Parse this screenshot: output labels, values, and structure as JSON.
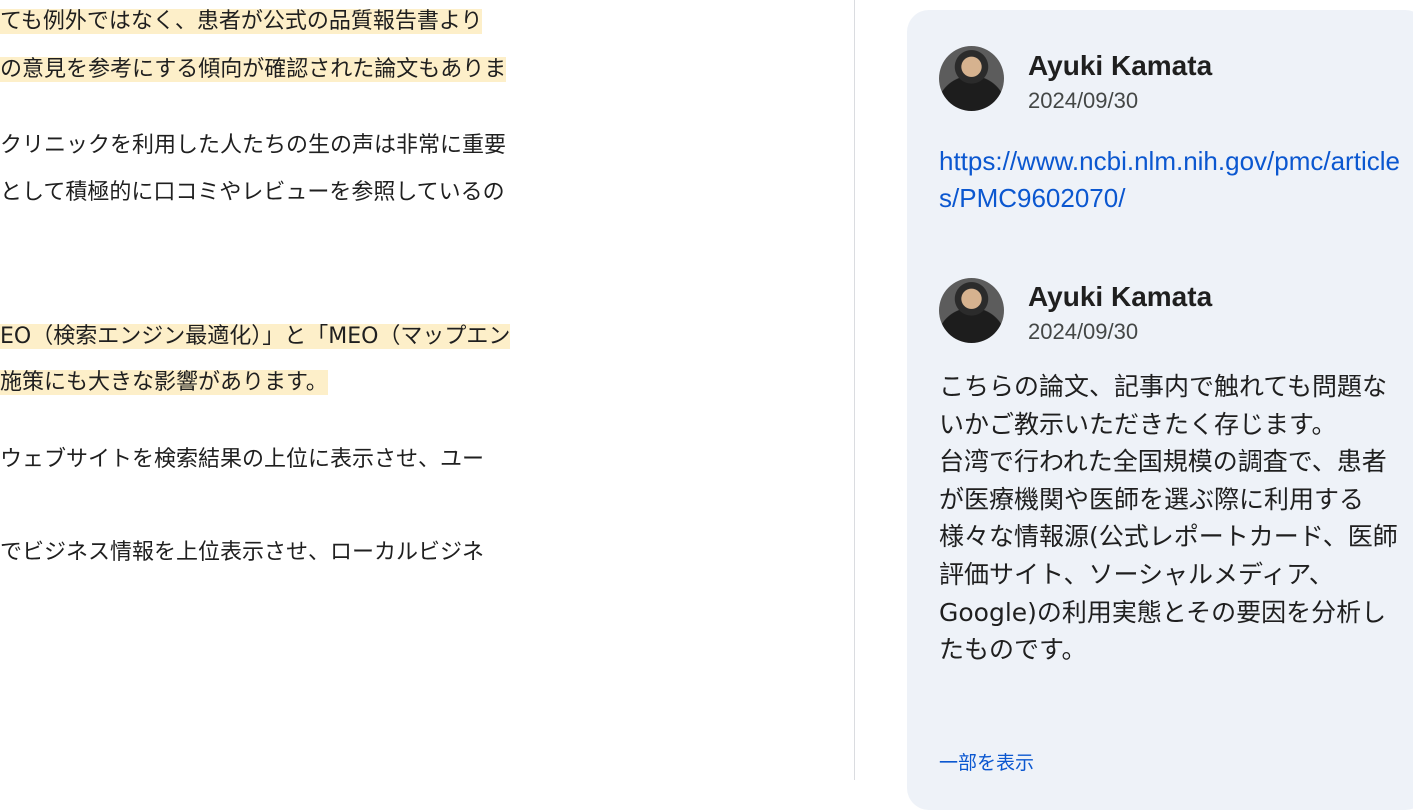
{
  "document": {
    "lines": [
      {
        "text": "ても例外ではなく、患者が公式の品質報告書より",
        "highlight": true
      },
      {
        "text": "の意見を参考にする傾向が確認された論文もありま",
        "highlight": true
      },
      {
        "text": "クリニックを利用した人たちの生の声は非常に重要",
        "highlight": false
      },
      {
        "text": "として積極的に口コミやレビューを参照しているの",
        "highlight": false
      },
      {
        "text": "EO（検索エンジン最適化）」と「MEO（マップエン",
        "highlight": true
      },
      {
        "text": "施策にも大きな影響があります。",
        "highlight": true
      },
      {
        "text": "ウェブサイトを検索結果の上位に表示させ、ユー",
        "highlight": false
      },
      {
        "text": "でビジネス情報を上位表示させ、ローカルビジネ",
        "highlight": false
      }
    ]
  },
  "comments": [
    {
      "author": "Ayuki Kamata",
      "date": "2024/09/30",
      "link": "https://www.ncbi.nlm.nih.gov/pmc/articles/PMC9602070/"
    },
    {
      "author": "Ayuki Kamata",
      "date": "2024/09/30",
      "text": "こちらの論文、記事内で触れても問題ないかご教示いただきたく存じます。\n台湾で行われた全国規模の調査で、患者が医療機関や医師を選ぶ際に利用する様々な情報源(公式レポートカード、医師評価サイト、ソーシャルメディア、Google)の利用実態とその要因を分析したものです。",
      "show_more": "一部を表示"
    }
  ],
  "colors": {
    "highlight": "#fdefc9",
    "link": "#0b57d0",
    "card": "#eef2f8"
  }
}
